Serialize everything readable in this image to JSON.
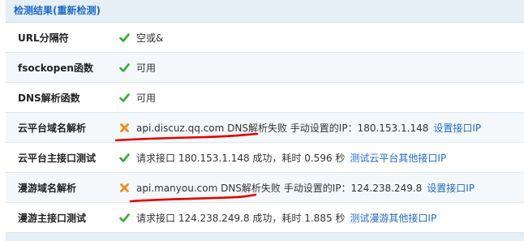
{
  "header": {
    "title": "检测结果(重新检测)"
  },
  "rows": [
    {
      "label": "URL分隔符",
      "status": "ok",
      "icon": "check-icon",
      "text": "空或&"
    },
    {
      "label": "fsockopen函数",
      "status": "ok",
      "icon": "check-icon",
      "text": "可用"
    },
    {
      "label": "DNS解析函数",
      "status": "ok",
      "icon": "check-icon",
      "text": "可用"
    },
    {
      "label": "云平台域名解析",
      "status": "fail",
      "icon": "cross-icon",
      "text": "api.discuz.qq.com DNS解析失败  手动设置的IP：180.153.1.148",
      "link": "设置接口IP"
    },
    {
      "label": "云平台主接口测试",
      "status": "ok",
      "icon": "check-icon",
      "text": "请求接口  180.153.1.148 成功，耗时  0.596 秒",
      "link": "测试云平台其他接口IP"
    },
    {
      "label": "漫游域名解析",
      "status": "fail",
      "icon": "cross-icon",
      "text": "api.manyou.com DNS解析失败  手动设置的IP：124.238.249.8",
      "link": "设置接口IP"
    },
    {
      "label": "漫游主接口测试",
      "status": "ok",
      "icon": "check-icon",
      "text": "请求接口  124.238.249.8 成功，耗时  1.885 秒",
      "link": "测试漫游其他接口IP"
    }
  ],
  "colors": {
    "header_bg": "#e6eef6",
    "header_text": "#1f6bbf",
    "link": "#1f6bbf",
    "ok_green": "#3aa83a",
    "fail_orange": "#f08a1e",
    "annotation_red": "#e00000"
  }
}
